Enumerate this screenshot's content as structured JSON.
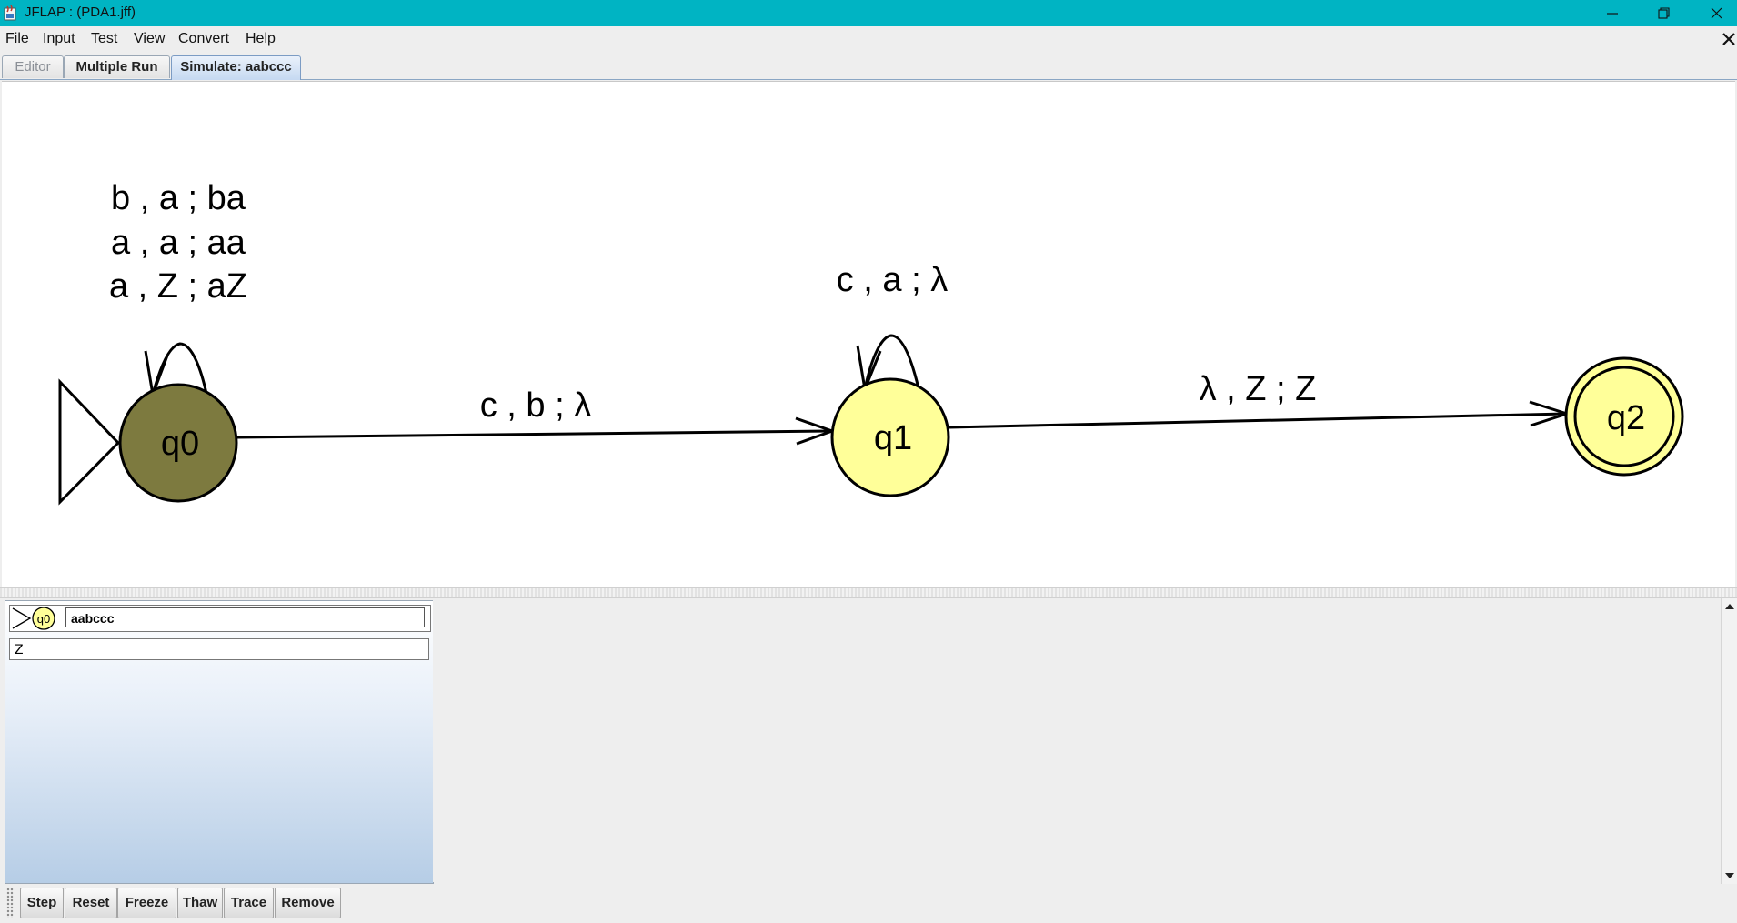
{
  "window": {
    "title": "JFLAP : (PDA1.jff)"
  },
  "menu": [
    "File",
    "Input",
    "Test",
    "View",
    "Convert",
    "Help"
  ],
  "tabs": [
    "Editor",
    "Multiple Run",
    "Simulate: aabccc"
  ],
  "automaton": {
    "states": [
      "q0",
      "q1",
      "q2"
    ],
    "loop_q0": [
      "b  , a ; ba",
      "a , a ; aa",
      "a , Z ; aZ"
    ],
    "loop_q1": "c , a ; λ",
    "edge_q0_q1": "c , b ; λ",
    "edge_q1_q2": "λ , Z ; Z",
    "initial_state": "q0",
    "final_state": "q2",
    "current_state": "q0",
    "colors": {
      "state_fill": "#ffff99",
      "current_fill": "#7d7a3f",
      "final_fill": "#ffff99"
    }
  },
  "configuration": {
    "state": "q0",
    "input": "aabccc",
    "stack": "Z"
  },
  "buttons": [
    "Step",
    "Reset",
    "Freeze",
    "Thaw",
    "Trace",
    "Remove"
  ]
}
